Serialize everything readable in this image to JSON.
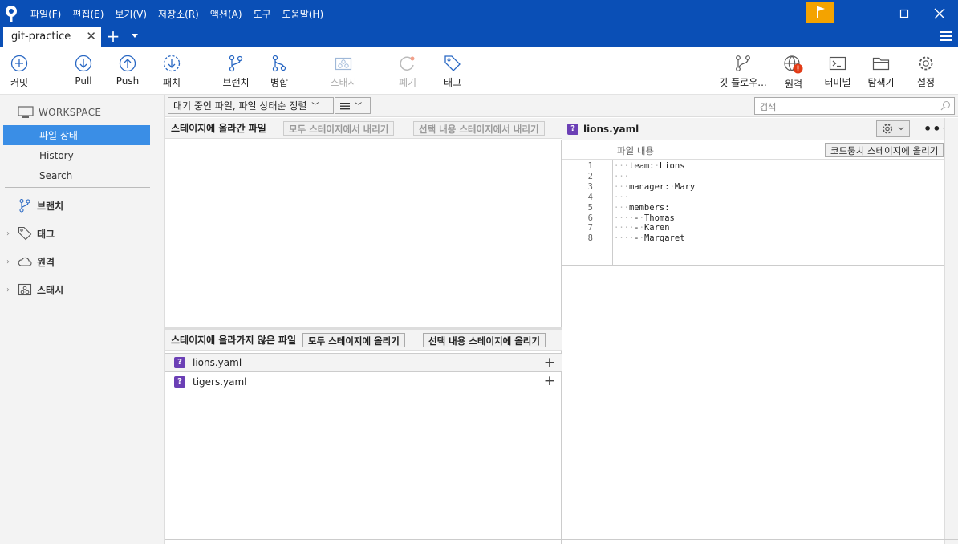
{
  "menu": [
    "파일(F)",
    "편집(E)",
    "보기(V)",
    "저장소(R)",
    "액션(A)",
    "도구",
    "도움말(H)"
  ],
  "tab": {
    "title": "git-practice"
  },
  "toolbar": {
    "commit": "커밋",
    "pull": "Pull",
    "push": "Push",
    "fetch": "패치",
    "branch": "브랜치",
    "merge": "병합",
    "stash": "스태시",
    "discard": "폐기",
    "tag": "태그",
    "gitflow": "깃 플로우...",
    "remote": "원격",
    "terminal": "터미널",
    "explorer": "탐색기",
    "settings": "설정"
  },
  "sidebar": {
    "workspace": "WORKSPACE",
    "items": [
      "파일 상태",
      "History",
      "Search"
    ],
    "groups": [
      "브랜치",
      "태그",
      "원격",
      "스태시"
    ]
  },
  "filter": {
    "dropdown": "대기 중인 파일, 파일 상태순 정렬",
    "search_placeholder": "검색"
  },
  "staged": {
    "title": "스테이지에 올라간 파일",
    "unstage_all": "모두 스테이지에서 내리기",
    "unstage_selected": "선택 내용 스테이지에서 내리기"
  },
  "unstaged": {
    "title": "스테이지에 올라가지 않은 파일",
    "stage_all": "모두 스테이지에 올리기",
    "stage_selected": "선택 내용 스테이지에 올리기",
    "files": [
      "lions.yaml",
      "tigers.yaml"
    ]
  },
  "diff": {
    "filename": "lions.yaml",
    "content_label": "파일 내용",
    "stage_hunk": "코드뭉치 스테이지에 올리기",
    "lines": [
      {
        "n": "1",
        "text": "team: Lions",
        "indent": 1
      },
      {
        "n": "2",
        "text": "",
        "indent": 1
      },
      {
        "n": "3",
        "text": "manager: Mary",
        "indent": 1
      },
      {
        "n": "4",
        "text": "",
        "indent": 1
      },
      {
        "n": "5",
        "text": "members:",
        "indent": 1
      },
      {
        "n": "6",
        "text": "- Thomas",
        "indent": 2
      },
      {
        "n": "7",
        "text": "- Karen",
        "indent": 2
      },
      {
        "n": "8",
        "text": "- Margaret",
        "indent": 2
      }
    ]
  },
  "colors": {
    "titlebar": "#0a4fb6",
    "accent": "#3a8ee6",
    "flag": "#f4a300",
    "untracked": "#6b3fb5",
    "alert": "#e23b16"
  }
}
